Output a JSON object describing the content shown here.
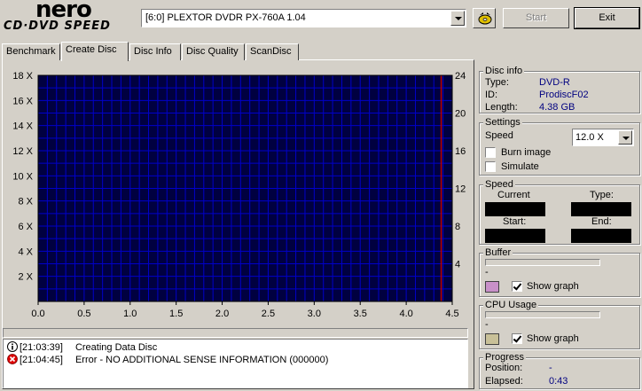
{
  "logo": {
    "brand": "nero",
    "product": "CD·DVD SPEED"
  },
  "toolbar": {
    "drive": "[6:0]  PLEXTOR DVDR   PX-760A 1.04",
    "start_label": "Start",
    "exit_label": "Exit"
  },
  "tabs": [
    {
      "label": "Benchmark",
      "active": false
    },
    {
      "label": "Create Disc",
      "active": true
    },
    {
      "label": "Disc Info",
      "active": false
    },
    {
      "label": "Disc Quality",
      "active": false
    },
    {
      "label": "ScanDisc",
      "active": false
    }
  ],
  "chart_data": {
    "type": "line",
    "x_ticks": [
      "0.0",
      "0.5",
      "1.0",
      "1.5",
      "2.0",
      "2.5",
      "3.0",
      "3.5",
      "4.0",
      "4.5"
    ],
    "y_left_ticks": [
      "2 X",
      "4 X",
      "6 X",
      "8 X",
      "10 X",
      "12 X",
      "14 X",
      "16 X",
      "18 X"
    ],
    "y_right_ticks": [
      "4",
      "8",
      "12",
      "16",
      "20",
      "24"
    ],
    "xlim": [
      0,
      4.5
    ],
    "ylim_left": [
      0,
      18
    ],
    "ylim_right": [
      0,
      24
    ],
    "grid": true,
    "markers": [
      {
        "x": 4.38,
        "color": "#c00000"
      }
    ],
    "colors": {
      "background": "#000040",
      "grid": "#0000c8",
      "marker": "#c00000"
    }
  },
  "log": [
    {
      "icon": "info-icon",
      "time": "[21:03:39]",
      "message": "Creating Data Disc"
    },
    {
      "icon": "error-icon",
      "time": "[21:04:45]",
      "message": "Error - NO ADDITIONAL SENSE INFORMATION (000000)"
    }
  ],
  "disc_info": {
    "title": "Disc info",
    "type_label": "Type:",
    "type_value": "DVD-R",
    "id_label": "ID:",
    "id_value": "ProdiscF02",
    "length_label": "Length:",
    "length_value": "4.38 GB"
  },
  "settings": {
    "title": "Settings",
    "speed_label": "Speed",
    "speed_value": "12.0 X",
    "burn_image_label": "Burn image",
    "burn_image_checked": false,
    "simulate_label": "Simulate",
    "simulate_checked": false
  },
  "speed": {
    "title": "Speed",
    "current_label": "Current",
    "type_label": "Type:",
    "start_label": "Start:",
    "end_label": "End:"
  },
  "buffer": {
    "title": "Buffer",
    "value": "-",
    "show_graph_label": "Show graph",
    "show_graph_checked": true,
    "color": "#c890c8"
  },
  "cpu": {
    "title": "CPU Usage",
    "value": "-",
    "show_graph_label": "Show graph",
    "show_graph_checked": true,
    "color": "#c8c098"
  },
  "progress": {
    "title": "Progress",
    "position_label": "Position:",
    "position_value": "-",
    "elapsed_label": "Elapsed:",
    "elapsed_value": "0:43"
  }
}
